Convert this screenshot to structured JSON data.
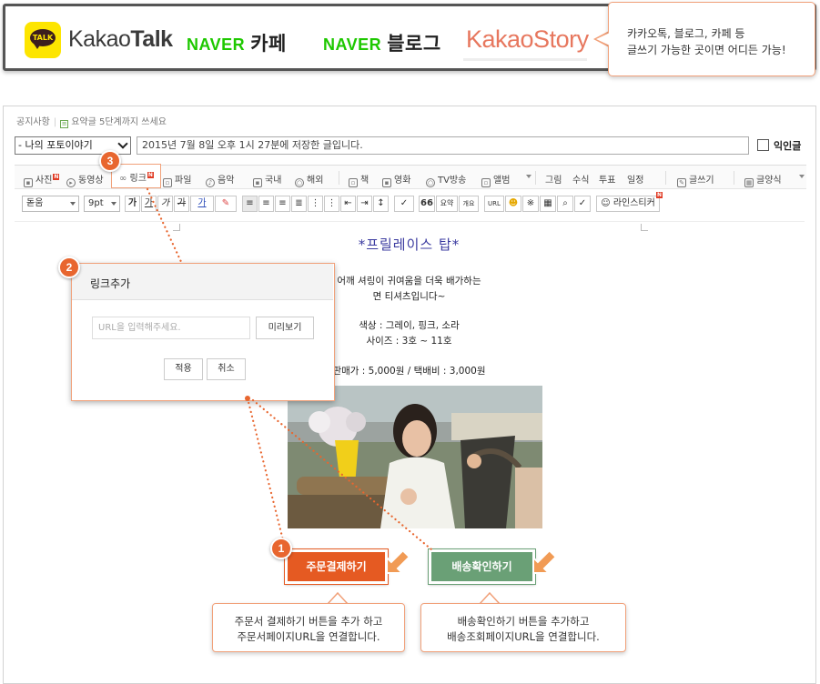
{
  "platforms": {
    "kakaotalk_badge": "TALK",
    "kakaotalk_pre": "Kakao",
    "kakaotalk_post": "Talk",
    "naver_word": "NAVER",
    "naver_cafe": "카페",
    "naver_blog": "블로그",
    "kakaostory": "KakaoStory",
    "callout_line1": "카카오톡, 블로그, 카페 등",
    "callout_line2": "글쓰기 가능한 곳이면 어디든 가능!"
  },
  "editor": {
    "notice_label": "공지사항",
    "notice_summary": "요약글 5단계까지 쓰세요",
    "category": "- 나의 포토이야기",
    "title_value": "2015년 7월 8일 오후 1시 27분에 저장한 글입니다.",
    "anon_label": "익인글"
  },
  "toolbar1": [
    {
      "label": "사진",
      "icon": "photo-icon",
      "badge": true
    },
    {
      "label": "동영상",
      "icon": "video-icon",
      "badge": false
    },
    {
      "label": "링크",
      "icon": "link-icon",
      "badge": true
    },
    {
      "label": "파일",
      "icon": "file-icon",
      "badge": false
    },
    {
      "label": "음악",
      "icon": "music-icon",
      "badge": false
    },
    {
      "label": "국내",
      "icon": "map-icon",
      "badge": false
    },
    {
      "label": "해외",
      "icon": "globe-icon",
      "badge": false
    },
    {
      "label": "책",
      "icon": "book-icon",
      "badge": false
    },
    {
      "label": "영화",
      "icon": "film-icon",
      "badge": false
    },
    {
      "label": "TV방송",
      "icon": "tv-icon",
      "badge": false
    },
    {
      "label": "앨범",
      "icon": "album-icon",
      "badge": false
    },
    {
      "label": "그림",
      "icon": "",
      "badge": false
    },
    {
      "label": "수식",
      "icon": "",
      "badge": false
    },
    {
      "label": "투표",
      "icon": "",
      "badge": false
    },
    {
      "label": "일정",
      "icon": "",
      "badge": false
    },
    {
      "label": "글쓰기",
      "icon": "pen-icon",
      "badge": false
    },
    {
      "label": "글양식",
      "icon": "template-icon",
      "badge": false
    }
  ],
  "toolbar2": {
    "font": "돋움",
    "size": "9pt",
    "fmt": [
      "가",
      "가",
      "가",
      "가",
      "가"
    ],
    "quote": "66",
    "summary": "요약",
    "summary_small": "개요",
    "url": "URL",
    "line_sticker": "라인스티커"
  },
  "document": {
    "title": "*프릴레이스 탑*",
    "line1": "어깨 셔링이 귀여움을 더욱 배가하는",
    "line2": "면 티셔츠입니다~",
    "line3": "색상 : 그레이, 핑크, 소라",
    "line4": "사이즈 : 3호 ~ 11호",
    "line5": "판매가 : 5,000원 / 택배비 : 3,000원"
  },
  "buttons": {
    "order": "주문결제하기",
    "ship": "배송확인하기"
  },
  "callouts": {
    "order_line1": "주문서 결제하기 버튼을 추가 하고",
    "order_line2": "주문서페이지URL을 연결합니다.",
    "ship_line1": "배송확인하기 버튼을 추가하고",
    "ship_line2": "배송조회페이지URL을 연결합니다."
  },
  "link_dialog": {
    "title": "링크추가",
    "url_placeholder": "URL을 입력해주세요.",
    "preview": "미리보기",
    "apply": "적용",
    "cancel": "취소"
  },
  "steps": {
    "one": "1",
    "two": "2",
    "three": "3"
  },
  "colors": {
    "accent": "#e8662f",
    "order_button": "#e55a22",
    "ship_button": "#6aa076",
    "naver_green": "#1ec800",
    "kakao_yellow": "#fde500",
    "kakaostory": "#e7775e"
  }
}
